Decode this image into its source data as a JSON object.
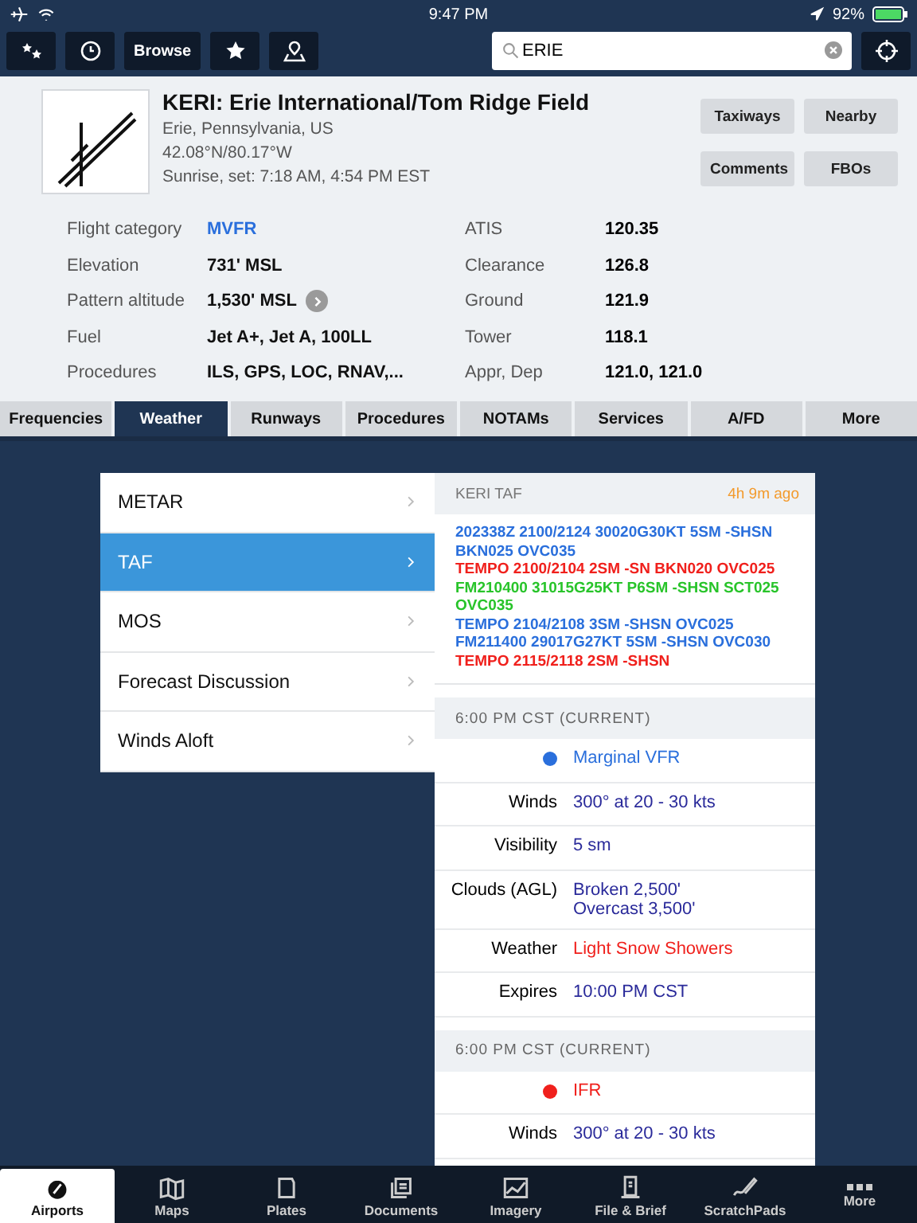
{
  "status_bar": {
    "time": "9:47 PM",
    "battery": "92%"
  },
  "toolbar": {
    "browse_label": "Browse",
    "search": {
      "value": "ERIE"
    }
  },
  "airport": {
    "title": "KERI: Erie International/Tom Ridge Field",
    "location": "Erie, Pennsylvania, US",
    "coordinates": "42.08°N/80.17°W",
    "sun": "Sunrise, set: 7:18 AM, 4:54 PM EST",
    "buttons": [
      "Taxiways",
      "Nearby",
      "Comments",
      "FBOs"
    ]
  },
  "info_left": [
    {
      "label": "Flight category",
      "value": "MVFR",
      "color": "#2a6fdc",
      "has_detail": false
    },
    {
      "label": "Elevation",
      "value": "731' MSL",
      "color": "#111111",
      "has_detail": false
    },
    {
      "label": "Pattern altitude",
      "value": "1,530' MSL",
      "color": "#111111",
      "has_detail": true
    },
    {
      "label": "Fuel",
      "value": "Jet A+, Jet A, 100LL",
      "color": "#111111",
      "has_detail": false
    },
    {
      "label": "Procedures",
      "value": "ILS, GPS, LOC, RNAV,...",
      "color": "#111111",
      "has_detail": false
    }
  ],
  "info_right": [
    {
      "label": "ATIS",
      "value": "120.35"
    },
    {
      "label": "Clearance",
      "value": "126.8"
    },
    {
      "label": "Ground",
      "value": "121.9"
    },
    {
      "label": "Tower",
      "value": "118.1"
    },
    {
      "label": "Appr, Dep",
      "value": "121.0, 121.0"
    }
  ],
  "tabs": [
    {
      "label": "Frequencies",
      "selected": false
    },
    {
      "label": "Weather",
      "selected": true
    },
    {
      "label": "Runways",
      "selected": false
    },
    {
      "label": "Procedures",
      "selected": false
    },
    {
      "label": "NOTAMs",
      "selected": false
    },
    {
      "label": "Services",
      "selected": false
    },
    {
      "label": "A/FD",
      "selected": false
    },
    {
      "label": "More",
      "selected": false
    }
  ],
  "menu": [
    {
      "label": "METAR",
      "selected": false
    },
    {
      "label": "TAF",
      "selected": true
    },
    {
      "label": "MOS",
      "selected": false
    },
    {
      "label": "Forecast Discussion",
      "selected": false
    },
    {
      "label": "Winds Aloft",
      "selected": false
    }
  ],
  "taf": {
    "title": "KERI TAF",
    "age": "4h 9m ago",
    "lines": [
      {
        "text": "202338Z 2100/2124 30020G30KT 5SM -SHSN BKN025 OVC035",
        "color": "#2a6fdc"
      },
      {
        "text": "TEMPO 2100/2104 2SM -SN BKN020 OVC025",
        "color": "#f0201c"
      },
      {
        "text": "FM210400 31015G25KT P6SM -SHSN SCT025 OVC035",
        "color": "#28c42a"
      },
      {
        "text": "TEMPO 2104/2108 3SM -SHSN OVC025",
        "color": "#2a6fdc"
      },
      {
        "text": "FM211400 29017G27KT 5SM -SHSN OVC030",
        "color": "#2a6fdc"
      },
      {
        "text": "TEMPO 2115/2118 2SM -SHSN",
        "color": "#f0201c"
      }
    ]
  },
  "forecasts": [
    {
      "header": "6:00 PM CST (CURRENT)",
      "rows": [
        {
          "kind": "category",
          "text": "Marginal VFR",
          "color": "#2a6fdc"
        },
        {
          "kind": "field",
          "label": "Winds",
          "values": [
            "300° at 20 - 30 kts"
          ],
          "color": "#2a2a9a"
        },
        {
          "kind": "field",
          "label": "Visibility",
          "values": [
            "5 sm"
          ],
          "color": "#2a2a9a"
        },
        {
          "kind": "field",
          "label": "Clouds (AGL)",
          "values": [
            "Broken 2,500'",
            "Overcast 3,500'"
          ],
          "color": "#2a2a9a"
        },
        {
          "kind": "field",
          "label": "Weather",
          "values": [
            "Light Snow Showers"
          ],
          "color": "#f0201c"
        },
        {
          "kind": "field",
          "label": "Expires",
          "values": [
            "10:00 PM CST"
          ],
          "color": "#2a2a9a"
        }
      ]
    },
    {
      "header": "6:00 PM CST (CURRENT)",
      "rows": [
        {
          "kind": "category",
          "text": "IFR",
          "color": "#f0201c"
        },
        {
          "kind": "field",
          "label": "Winds",
          "values": [
            "300° at 20 - 30 kts"
          ],
          "color": "#2a2a9a"
        }
      ]
    }
  ],
  "bottom_tabs": [
    {
      "label": "Airports",
      "selected": true
    },
    {
      "label": "Maps",
      "selected": false
    },
    {
      "label": "Plates",
      "selected": false
    },
    {
      "label": "Documents",
      "selected": false
    },
    {
      "label": "Imagery",
      "selected": false
    },
    {
      "label": "File & Brief",
      "selected": false
    },
    {
      "label": "ScratchPads",
      "selected": false
    },
    {
      "label": "More",
      "selected": false
    }
  ]
}
